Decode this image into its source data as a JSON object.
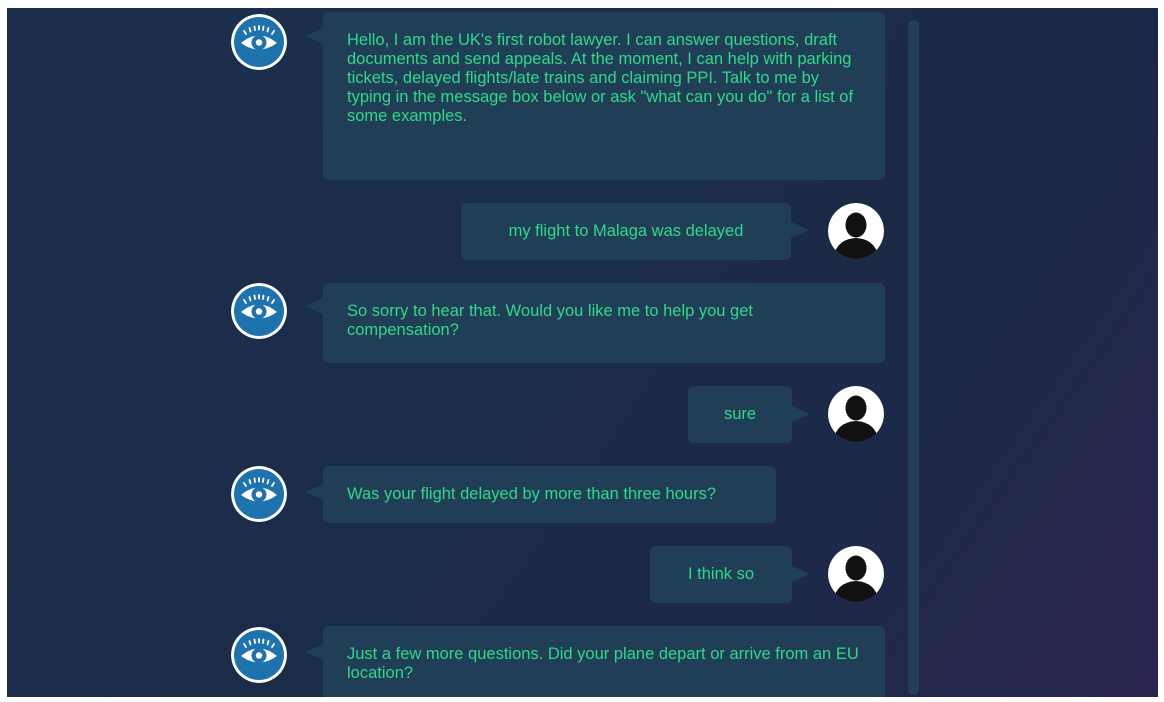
{
  "conversation": {
    "bot_icon": "eye-icon",
    "user_icon": "user-silhouette-icon",
    "colors": {
      "background": "#1b2c49",
      "bubble": "#203f56",
      "text": "#2fd88a",
      "bot_avatar": "#1f73ad"
    },
    "messages": [
      {
        "sender": "bot",
        "text": "Hello, I am the UK's first robot lawyer. I can answer questions, draft documents and send appeals. At the moment, I can help with parking tickets, delayed flights/late trains and claiming PPI. Talk to me by typing in the message box below or ask \"what can you do\" for a list of some examples."
      },
      {
        "sender": "user",
        "text": "my flight to Malaga was delayed"
      },
      {
        "sender": "bot",
        "text": "So sorry to hear that. Would you like me to help you get compensation?"
      },
      {
        "sender": "user",
        "text": "sure"
      },
      {
        "sender": "bot",
        "text": "Was your flight delayed by more than three hours?"
      },
      {
        "sender": "user",
        "text": "I think so"
      },
      {
        "sender": "bot",
        "text": "Just a few more questions. Did your plane depart or arrive from an EU location?"
      }
    ]
  }
}
